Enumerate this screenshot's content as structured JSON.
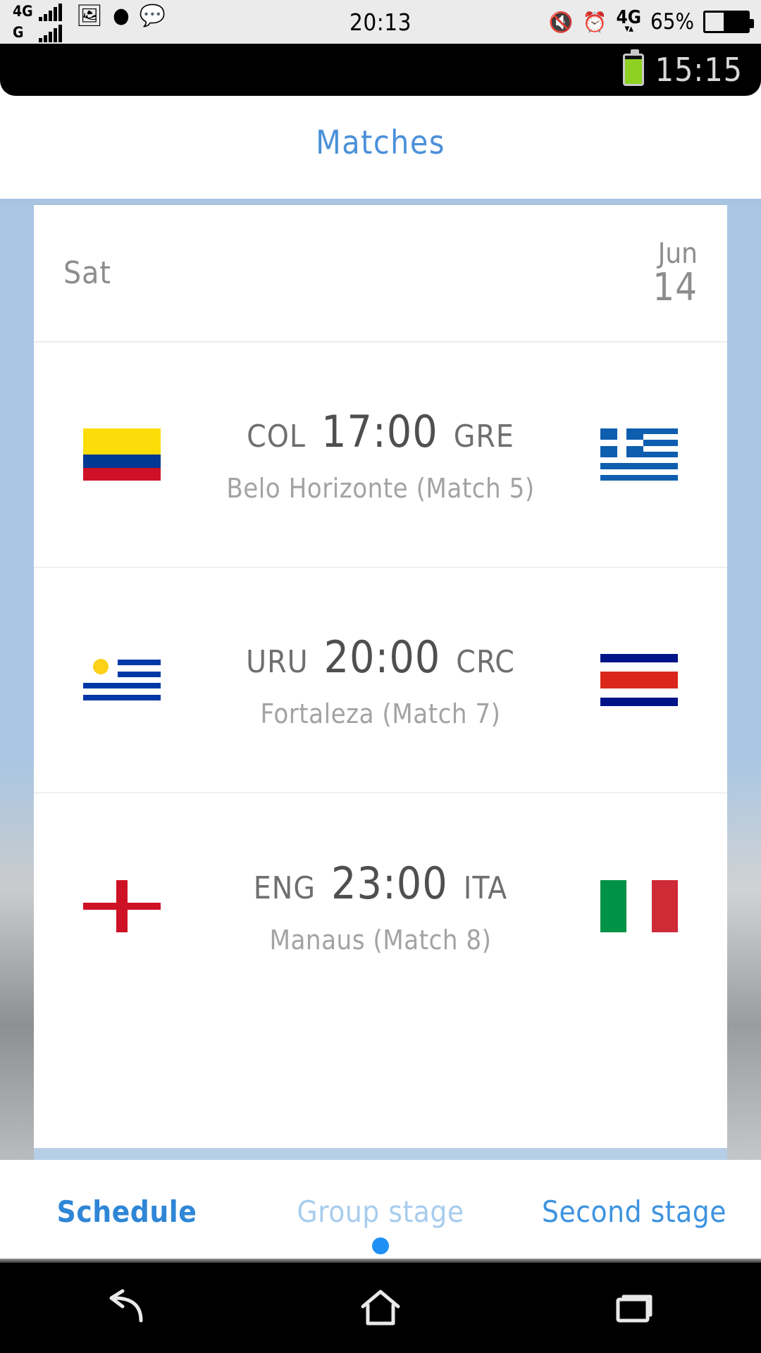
{
  "os_status": {
    "network_primary": "4G",
    "network_secondary": "G",
    "clock": "20:13",
    "battery_percent": "65%",
    "network_right": "4G",
    "icons": [
      "photo-icon",
      "penguin-icon",
      "wechat-icon",
      "mute-icon",
      "alarm-icon"
    ]
  },
  "app_status": {
    "clock": "15:15",
    "battery": "battery-full-icon"
  },
  "header": {
    "title": "Matches"
  },
  "date_header": {
    "day": "Sat",
    "month": "Jun",
    "date": "14"
  },
  "matches": [
    {
      "home": "COL",
      "away": "GRE",
      "time": "17:00",
      "venue": "Belo Horizonte (Match  5)",
      "home_flag": "colombia-flag",
      "away_flag": "greece-flag"
    },
    {
      "home": "URU",
      "away": "CRC",
      "time": "20:00",
      "venue": "Fortaleza (Match  7)",
      "home_flag": "uruguay-flag",
      "away_flag": "costa-rica-flag"
    },
    {
      "home": "ENG",
      "away": "ITA",
      "time": "23:00",
      "venue": "Manaus (Match  8)",
      "home_flag": "england-flag",
      "away_flag": "italy-flag"
    }
  ],
  "tabs": [
    {
      "label": "Schedule",
      "state": "active"
    },
    {
      "label": "Group stage",
      "state": "dim"
    },
    {
      "label": "Second stage",
      "state": "normal"
    }
  ],
  "navbar": {
    "back": "back-icon",
    "home": "home-icon",
    "recents": "recents-icon"
  },
  "colors": {
    "accent": "#2f86d6",
    "title": "#4a90d9",
    "frame_border": "#a8c4e0",
    "battery_green": "#8fd121",
    "dot": "#1e90f5"
  }
}
